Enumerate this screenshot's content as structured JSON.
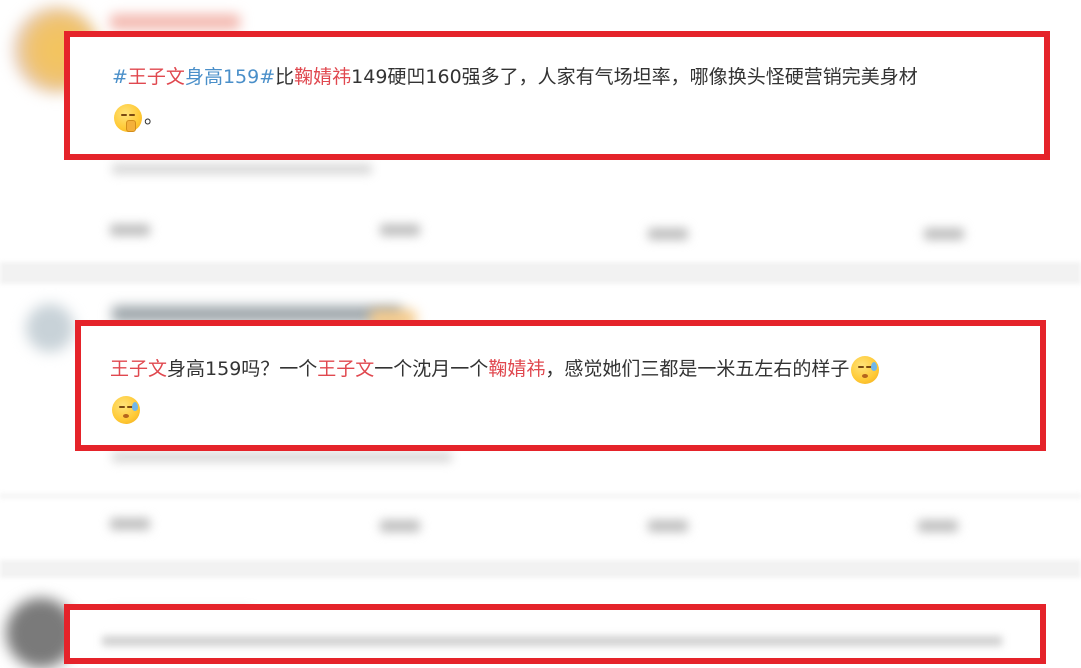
{
  "posts": [
    {
      "segments": [
        {
          "text": "#",
          "style": "topic"
        },
        {
          "text": "王子文",
          "style": "name"
        },
        {
          "text": "身高159#",
          "style": "topic"
        },
        {
          "text": "比",
          "style": "plain"
        },
        {
          "text": "鞠婧祎",
          "style": "name"
        },
        {
          "text": "149硬凹160强多了，人家有气场坦率，哪像换头怪硬营销完美身材",
          "style": "plain"
        }
      ],
      "emoji": "shush-face-icon",
      "tail": "。"
    },
    {
      "segments": [
        {
          "text": "王子文",
          "style": "name"
        },
        {
          "text": "身高159吗？一个",
          "style": "plain"
        },
        {
          "text": "王子文",
          "style": "name"
        },
        {
          "text": "一个沈月一个",
          "style": "plain"
        },
        {
          "text": "鞠婧祎",
          "style": "name"
        },
        {
          "text": "，感觉她们三都是一米五左右的样子",
          "style": "plain"
        }
      ],
      "emoji": "sweat-face-icon"
    }
  ],
  "colors": {
    "highlight_border": "#e5232a",
    "topic_link": "#4a8fc9",
    "name_highlight": "#e0484f",
    "body_text": "#333333"
  }
}
